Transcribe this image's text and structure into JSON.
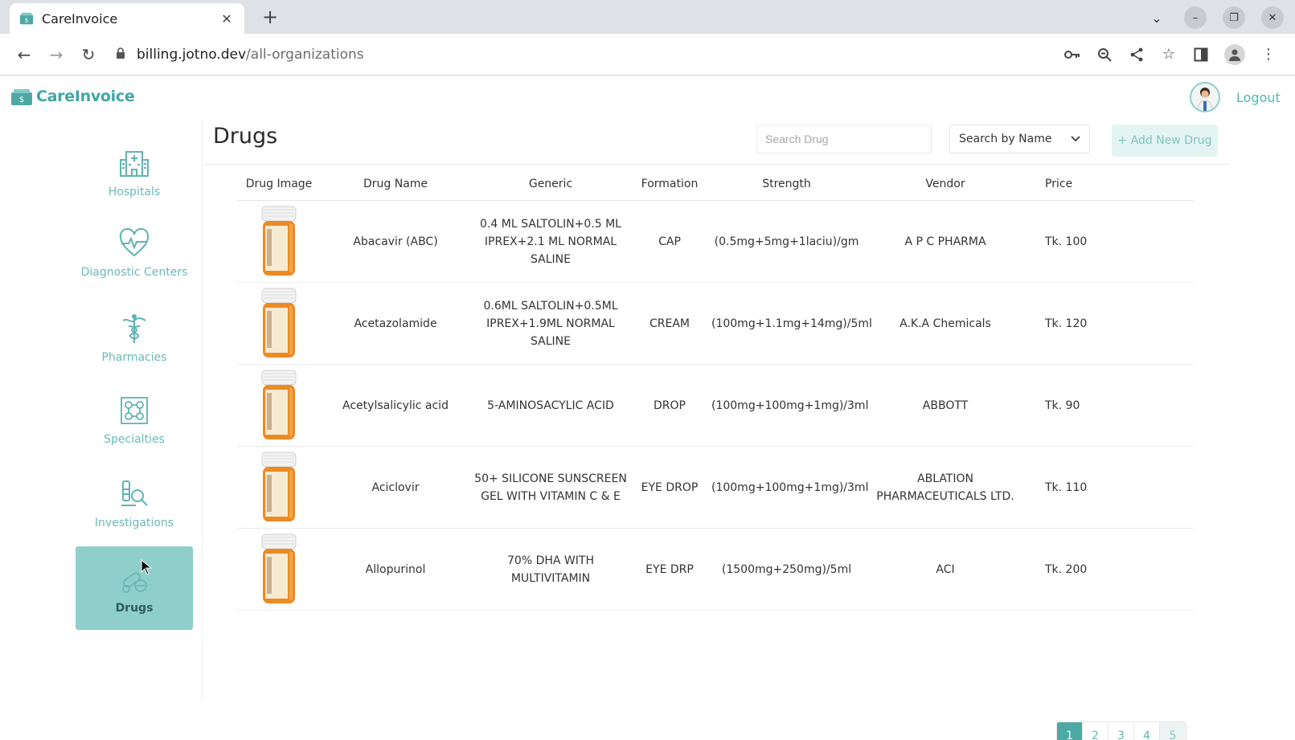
{
  "browser": {
    "tab_title": "CareInvoice",
    "url_host": "billing.jotno.dev",
    "url_path": "/all-organizations"
  },
  "app": {
    "brand": "CareInvoice",
    "logout_label": "Logout",
    "page_title": "Drugs",
    "search_placeholder": "Search Drug",
    "search_by_value": "Search by Name",
    "add_button_label": "+ Add New Drug"
  },
  "sidebar": {
    "items": [
      {
        "label": "Hospitals",
        "icon": "hospital-icon"
      },
      {
        "label": "Diagnostic Centers",
        "icon": "heartbeat-icon"
      },
      {
        "label": "Pharmacies",
        "icon": "caduceus-icon"
      },
      {
        "label": "Specialties",
        "icon": "specialties-icon"
      },
      {
        "label": "Investigations",
        "icon": "microscope-icon"
      },
      {
        "label": "Drugs",
        "icon": "pills-icon",
        "active": true
      }
    ]
  },
  "table": {
    "headers": [
      "Drug Image",
      "Drug Name",
      "Generic",
      "Formation",
      "Strength",
      "Vendor",
      "Price"
    ],
    "rows": [
      {
        "name": "Abacavir (ABC)",
        "generic": "0.4 ML SALTOLIN+0.5 ML IPREX+2.1 ML NORMAL SALINE",
        "formation": "CAP",
        "strength": "(0.5mg+5mg+1laciu)/gm",
        "vendor": "A P C PHARMA",
        "price": "Tk. 100"
      },
      {
        "name": "Acetazolamide",
        "generic": "0.6ML SALTOLIN+0.5ML IPREX+1.9ML NORMAL SALINE",
        "formation": "CREAM",
        "strength": "(100mg+1.1mg+14mg)/5ml",
        "vendor": "A.K.A Chemicals",
        "price": "Tk. 120"
      },
      {
        "name": "Acetylsalicylic acid",
        "generic": "5-AMINOSACYLIC ACID",
        "formation": "DROP",
        "strength": "(100mg+100mg+1mg)/3ml",
        "vendor": "ABBOTT",
        "price": "Tk. 90"
      },
      {
        "name": "Aciclovir",
        "generic": "50+ SILICONE SUNSCREEN GEL WITH VITAMIN C & E",
        "formation": "EYE DROP",
        "strength": "(100mg+100mg+1mg)/3ml",
        "vendor": "ABLATION PHARMACEUTICALS LTD.",
        "price": "Tk. 110"
      },
      {
        "name": "Allopurinol",
        "generic": "70% DHA WITH MULTIVITAMIN",
        "formation": "EYE DRP",
        "strength": "(1500mg+250mg)/5ml",
        "vendor": "ACI",
        "price": "Tk. 200"
      }
    ]
  },
  "pagination": {
    "pages": [
      "1",
      "2",
      "3",
      "4",
      "5"
    ],
    "current": "1"
  },
  "colors": {
    "accent": "#4ea9a5",
    "accent_light": "#8fcfcb",
    "sidebar_label": "#6ab9b6"
  }
}
